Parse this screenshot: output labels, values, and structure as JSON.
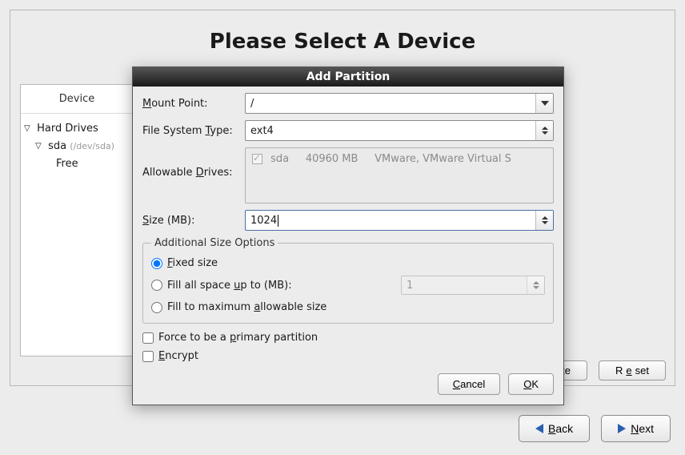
{
  "page": {
    "title": "Please Select A Device"
  },
  "tree": {
    "header": "Device",
    "hard_drives_label": "Hard Drives",
    "sda_label": "sda",
    "sda_path": "(/dev/sda)",
    "free_label": "Free"
  },
  "bottom_buttons": {
    "delete": "ete",
    "reset_prefix": "R",
    "reset_u": "e",
    "reset_suffix": "set"
  },
  "nav": {
    "back_u": "B",
    "back_suffix": "ack",
    "next_u": "N",
    "next_suffix": "ext"
  },
  "dialog": {
    "title": "Add Partition",
    "labels": {
      "mount_u": "M",
      "mount_rest": "ount Point:",
      "fstype_prefix": "File System ",
      "fstype_u": "T",
      "fstype_suffix": "ype:",
      "drives_prefix": "Allowable ",
      "drives_u": "D",
      "drives_suffix": "rives:",
      "size_u": "S",
      "size_rest": "ize (MB):",
      "addl": "Additional Size Options",
      "fixed_u": "F",
      "fixed_rest": "ixed size",
      "fillup_prefix": "Fill all space ",
      "fillup_u": "u",
      "fillup_suffix": "p to (MB):",
      "fillmax_prefix": "Fill to maximum ",
      "fillmax_u": "a",
      "fillmax_suffix": "llowable size",
      "force_prefix": "Force to be a ",
      "force_u": "p",
      "force_suffix": "rimary partition",
      "encrypt_u": "E",
      "encrypt_rest": "ncrypt"
    },
    "values": {
      "mount_point": "/",
      "fs_type": "ext4",
      "drive_name": "sda",
      "drive_size": "40960 MB",
      "drive_desc": "VMware, VMware Virtual S",
      "size_mb": "1024",
      "fill_up_value": "1"
    },
    "buttons": {
      "cancel_u": "C",
      "cancel_rest": "ancel",
      "ok_u": "O",
      "ok_rest": "K"
    }
  }
}
